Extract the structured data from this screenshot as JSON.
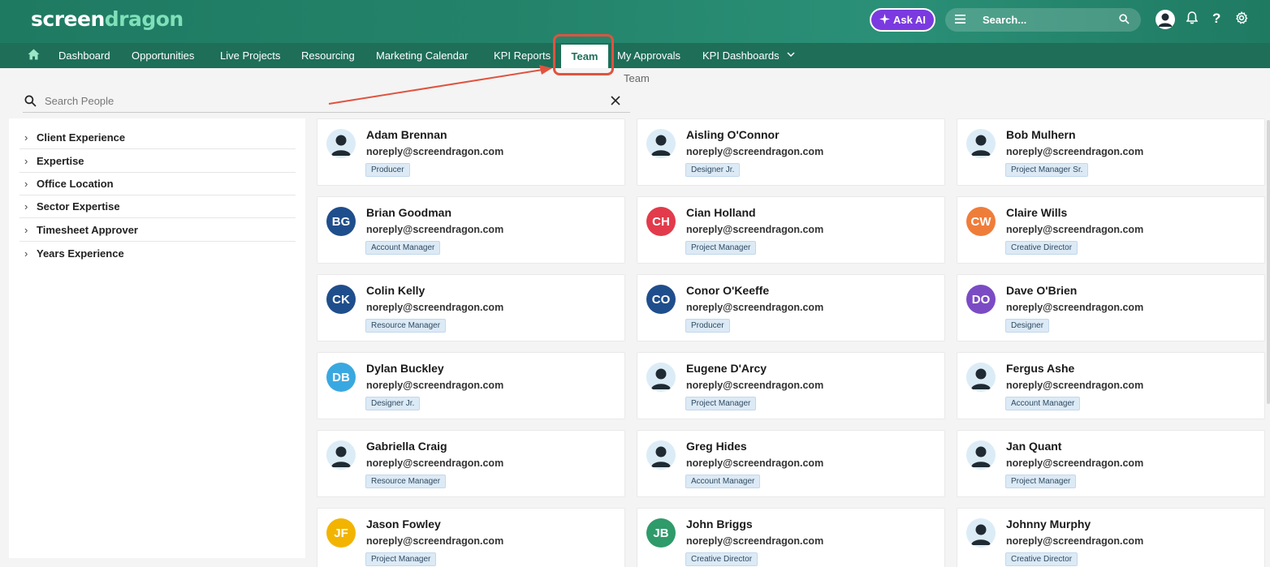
{
  "header": {
    "logo_part1": "screen",
    "logo_part2": "dragon",
    "ask_ai_label": "Ask AI",
    "search_placeholder": "Search..."
  },
  "nav": {
    "items": [
      {
        "label": "Dashboard"
      },
      {
        "label": "Opportunities"
      },
      {
        "label": "Live Projects"
      },
      {
        "label": "Resourcing"
      },
      {
        "label": "Marketing Calendar"
      },
      {
        "label": "KPI Reports"
      },
      {
        "label": "Team"
      },
      {
        "label": "My Approvals"
      },
      {
        "label": "KPI Dashboards"
      }
    ],
    "active": "Team"
  },
  "breadcrumb": "Team",
  "people_search": {
    "placeholder": "Search People"
  },
  "filters": [
    "Client Experience",
    "Expertise",
    "Office Location",
    "Sector Expertise",
    "Timesheet Approver",
    "Years Experience"
  ],
  "people": [
    {
      "name": "Adam Brennan",
      "email": "noreply@screendragon.com",
      "role": "Producer",
      "initials": "",
      "color": ""
    },
    {
      "name": "Aisling O'Connor",
      "email": "noreply@screendragon.com",
      "role": "Designer Jr.",
      "initials": "",
      "color": ""
    },
    {
      "name": "Bob Mulhern",
      "email": "noreply@screendragon.com",
      "role": "Project Manager Sr.",
      "initials": "",
      "color": ""
    },
    {
      "name": "Brian Goodman",
      "email": "noreply@screendragon.com",
      "role": "Account Manager",
      "initials": "BG",
      "color": "#1f4e8c"
    },
    {
      "name": "Cian Holland",
      "email": "noreply@screendragon.com",
      "role": "Project Manager",
      "initials": "CH",
      "color": "#e23b4b"
    },
    {
      "name": "Claire Wills",
      "email": "noreply@screendragon.com",
      "role": "Creative Director",
      "initials": "CW",
      "color": "#ef7d3a"
    },
    {
      "name": "Colin Kelly",
      "email": "noreply@screendragon.com",
      "role": "Resource Manager",
      "initials": "CK",
      "color": "#1f4e8c"
    },
    {
      "name": "Conor O'Keeffe",
      "email": "noreply@screendragon.com",
      "role": "Producer",
      "initials": "CO",
      "color": "#1f4e8c"
    },
    {
      "name": "Dave O'Brien",
      "email": "noreply@screendragon.com",
      "role": "Designer",
      "initials": "DO",
      "color": "#7b4bc4"
    },
    {
      "name": "Dylan Buckley",
      "email": "noreply@screendragon.com",
      "role": "Designer Jr.",
      "initials": "DB",
      "color": "#3aa8e0"
    },
    {
      "name": "Eugene D'Arcy",
      "email": "noreply@screendragon.com",
      "role": "Project Manager",
      "initials": "",
      "color": ""
    },
    {
      "name": "Fergus Ashe",
      "email": "noreply@screendragon.com",
      "role": "Account Manager",
      "initials": "",
      "color": ""
    },
    {
      "name": "Gabriella Craig",
      "email": "noreply@screendragon.com",
      "role": "Resource Manager",
      "initials": "",
      "color": ""
    },
    {
      "name": "Greg Hides",
      "email": "noreply@screendragon.com",
      "role": "Account Manager",
      "initials": "",
      "color": ""
    },
    {
      "name": "Jan Quant",
      "email": "noreply@screendragon.com",
      "role": "Project Manager",
      "initials": "",
      "color": ""
    },
    {
      "name": "Jason Fowley",
      "email": "noreply@screendragon.com",
      "role": "Project Manager",
      "initials": "JF",
      "color": "#f2b400"
    },
    {
      "name": "John Briggs",
      "email": "noreply@screendragon.com",
      "role": "Creative Director",
      "initials": "JB",
      "color": "#2f9a6a"
    },
    {
      "name": "Johnny Murphy",
      "email": "noreply@screendragon.com",
      "role": "Creative Director",
      "initials": "",
      "color": ""
    }
  ],
  "colors": {
    "header": "#23836a",
    "nav": "#1e6e58",
    "ask_ai": "#7a3ae0",
    "annotation": "#e0533f"
  }
}
